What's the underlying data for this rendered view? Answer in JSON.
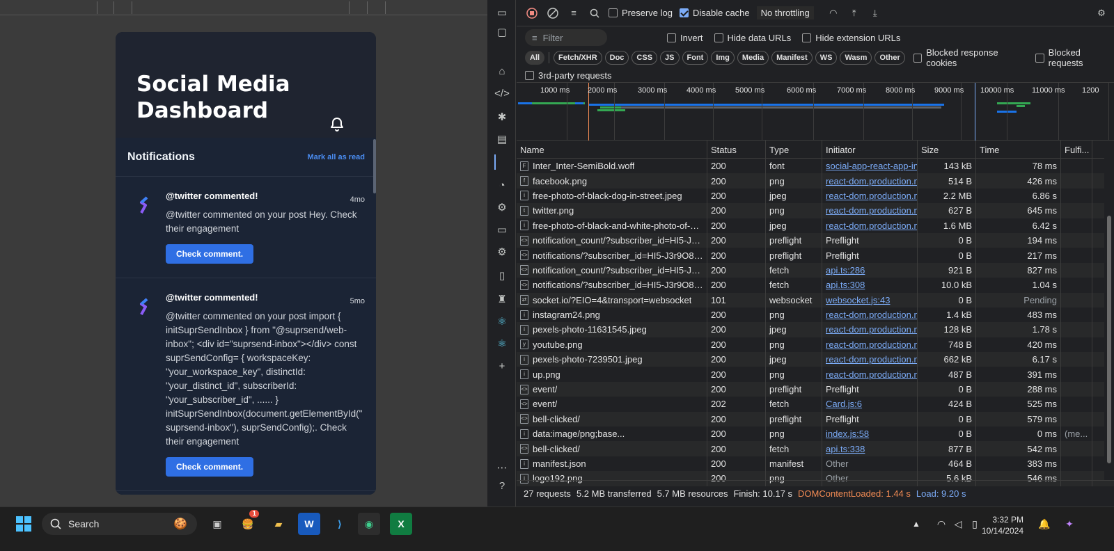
{
  "app": {
    "title": "Social Media Dashboard",
    "notifications_title": "Notifications",
    "mark_all_read": "Mark all as read",
    "notifications": [
      {
        "title": "@twitter commented!",
        "time": "4mo",
        "body": "@twitter commented on your post Hey. Check their engagement",
        "button": "Check comment."
      },
      {
        "title": "@twitter commented!",
        "time": "5mo",
        "body": "@twitter commented on your post import { initSuprSendInbox } from \"@suprsend/web-inbox\"; <div id=\"suprsend-inbox\"></div> const suprSendConfig= { workspaceKey: \"your_workspace_key\", distinctId: \"your_distinct_id\", subscriberId: \"your_subscriber_id\", ...... } initSuprSendInbox(document.getElementById(\"suprsend-inbox\"), suprSendConfig);. Check their engagement",
        "button": "Check comment."
      }
    ]
  },
  "devtools": {
    "toolbar": {
      "preserve_log": "Preserve log",
      "disable_cache": "Disable cache",
      "throttling": "No throttling"
    },
    "filter": {
      "placeholder": "Filter",
      "invert": "Invert",
      "hide_data_urls": "Hide data URLs",
      "hide_extension_urls": "Hide extension URLs"
    },
    "type_filters": [
      "All",
      "Fetch/XHR",
      "Doc",
      "CSS",
      "JS",
      "Font",
      "Img",
      "Media",
      "Manifest",
      "WS",
      "Wasm",
      "Other"
    ],
    "blocked_response_cookies": "Blocked response cookies",
    "blocked_requests": "Blocked requests",
    "third_party": "3rd-party requests",
    "overview_labels": [
      "1000 ms",
      "2000 ms",
      "3000 ms",
      "4000 ms",
      "5000 ms",
      "6000 ms",
      "7000 ms",
      "8000 ms",
      "9000 ms",
      "10000 ms",
      "11000 ms",
      "1200"
    ],
    "columns": [
      "Name",
      "Status",
      "Type",
      "Initiator",
      "Size",
      "Time",
      "Fulfi..."
    ],
    "rows": [
      {
        "name": "Inter_Inter-SemiBold.woff",
        "status": "200",
        "type": "font",
        "initiator": "social-app-react-app-inb",
        "init_link": true,
        "size": "143 kB",
        "time": "78 ms",
        "icon": "F"
      },
      {
        "name": "facebook.png",
        "status": "200",
        "type": "png",
        "initiator": "react-dom.production.m",
        "init_link": true,
        "size": "514 B",
        "time": "426 ms",
        "icon": "f"
      },
      {
        "name": "free-photo-of-black-dog-in-street.jpeg",
        "status": "200",
        "type": "jpeg",
        "initiator": "react-dom.production.m",
        "init_link": true,
        "size": "2.2 MB",
        "time": "6.86 s",
        "icon": "i"
      },
      {
        "name": "twitter.png",
        "status": "200",
        "type": "png",
        "initiator": "react-dom.production.m",
        "init_link": true,
        "size": "627 B",
        "time": "645 ms",
        "icon": "t"
      },
      {
        "name": "free-photo-of-black-and-white-photo-of-a-...",
        "status": "200",
        "type": "jpeg",
        "initiator": "react-dom.production.m",
        "init_link": true,
        "size": "1.6 MB",
        "time": "6.42 s",
        "icon": "i"
      },
      {
        "name": "notification_count/?subscriber_id=HI5-J3r9...",
        "status": "200",
        "type": "preflight",
        "initiator": "Preflight",
        "init_link": false,
        "size": "0 B",
        "time": "194 ms",
        "icon": "<>"
      },
      {
        "name": "notifications/?subscriber_id=HI5-J3r9O8i9A...",
        "status": "200",
        "type": "preflight",
        "initiator": "Preflight",
        "init_link": false,
        "size": "0 B",
        "time": "217 ms",
        "icon": "<>"
      },
      {
        "name": "notification_count/?subscriber_id=HI5-J3r9...",
        "status": "200",
        "type": "fetch",
        "initiator": "api.ts:286",
        "init_link": true,
        "size": "921 B",
        "time": "827 ms",
        "icon": "<>"
      },
      {
        "name": "notifications/?subscriber_id=HI5-J3r9O8i9A...",
        "status": "200",
        "type": "fetch",
        "initiator": "api.ts:308",
        "init_link": true,
        "size": "10.0 kB",
        "time": "1.04 s",
        "icon": "<>"
      },
      {
        "name": "socket.io/?EIO=4&transport=websocket",
        "status": "101",
        "type": "websocket",
        "initiator": "websocket.js:43",
        "init_link": true,
        "size": "0 B",
        "time": "Pending",
        "icon": "⇄"
      },
      {
        "name": "instagram24.png",
        "status": "200",
        "type": "png",
        "initiator": "react-dom.production.m",
        "init_link": true,
        "size": "1.4 kB",
        "time": "483 ms",
        "icon": "i"
      },
      {
        "name": "pexels-photo-11631545.jpeg",
        "status": "200",
        "type": "jpeg",
        "initiator": "react-dom.production.m",
        "init_link": true,
        "size": "128 kB",
        "time": "1.78 s",
        "icon": "i"
      },
      {
        "name": "youtube.png",
        "status": "200",
        "type": "png",
        "initiator": "react-dom.production.m",
        "init_link": true,
        "size": "748 B",
        "time": "420 ms",
        "icon": "y"
      },
      {
        "name": "pexels-photo-7239501.jpeg",
        "status": "200",
        "type": "jpeg",
        "initiator": "react-dom.production.m",
        "init_link": true,
        "size": "662 kB",
        "time": "6.17 s",
        "icon": "i"
      },
      {
        "name": "up.png",
        "status": "200",
        "type": "png",
        "initiator": "react-dom.production.m",
        "init_link": true,
        "size": "487 B",
        "time": "391 ms",
        "icon": "i"
      },
      {
        "name": "event/",
        "status": "200",
        "type": "preflight",
        "initiator": "Preflight",
        "init_link": false,
        "size": "0 B",
        "time": "288 ms",
        "icon": "<>"
      },
      {
        "name": "event/",
        "status": "202",
        "type": "fetch",
        "initiator": "Card.js:6",
        "init_link": true,
        "size": "424 B",
        "time": "525 ms",
        "icon": "<>"
      },
      {
        "name": "bell-clicked/",
        "status": "200",
        "type": "preflight",
        "initiator": "Preflight",
        "init_link": false,
        "size": "0 B",
        "time": "579 ms",
        "icon": "<>"
      },
      {
        "name": "data:image/png;base...",
        "status": "200",
        "type": "png",
        "initiator": "index.js:58",
        "init_link": true,
        "size": "0 B",
        "time": "0 ms",
        "fulfilled": "(me...",
        "icon": "i"
      },
      {
        "name": "bell-clicked/",
        "status": "200",
        "type": "fetch",
        "initiator": "api.ts:338",
        "init_link": true,
        "size": "877 B",
        "time": "542 ms",
        "icon": "<>"
      },
      {
        "name": "manifest.json",
        "status": "200",
        "type": "manifest",
        "initiator": "Other",
        "init_link": false,
        "size": "464 B",
        "time": "383 ms",
        "icon": "i"
      },
      {
        "name": "logo192.png",
        "status": "200",
        "type": "png",
        "initiator": "Other",
        "init_link": false,
        "size": "5.6 kB",
        "time": "546 ms",
        "icon": "i"
      }
    ],
    "status": {
      "requests": "27 requests",
      "transferred": "5.2 MB transferred",
      "resources": "5.7 MB resources",
      "finish": "Finish: 10.17 s",
      "dcl": "DOMContentLoaded: 1.44 s",
      "load": "Load: 9.20 s"
    },
    "colors": {
      "dcl": "#f28b54",
      "load": "#7cacf8",
      "link": "#7cacf8"
    }
  },
  "taskbar": {
    "search": "Search",
    "time": "3:32 PM",
    "date": "10/14/2024",
    "badge": "1"
  }
}
